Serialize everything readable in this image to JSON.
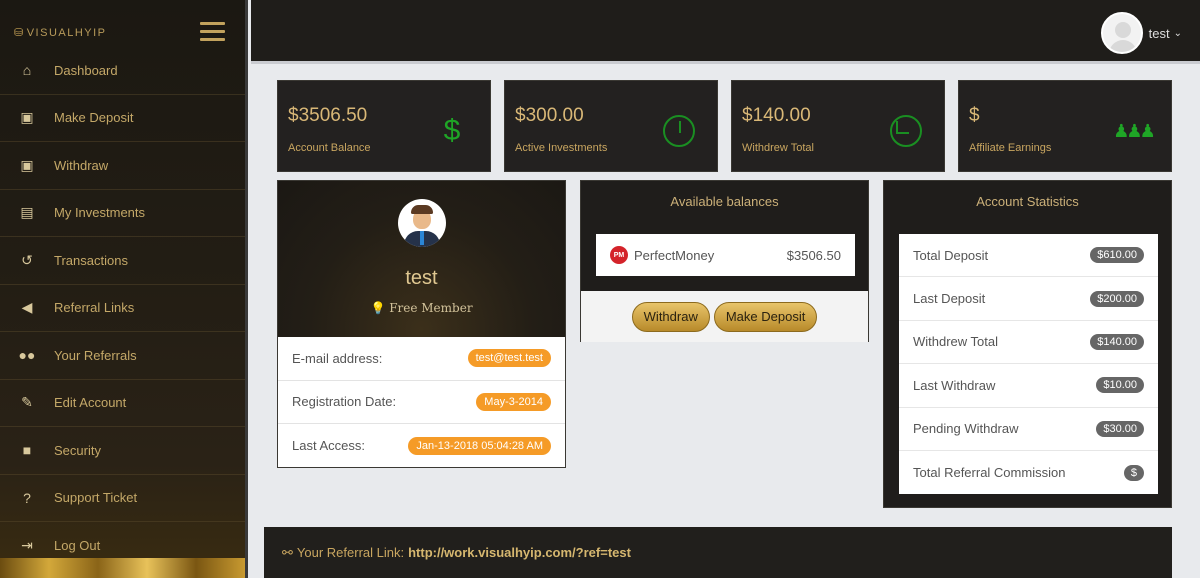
{
  "brand": {
    "name": "VISUALHYIP"
  },
  "sidebar": {
    "items": [
      {
        "label": "Dashboard",
        "icon": "home-icon"
      },
      {
        "label": "Make Deposit",
        "icon": "money-icon"
      },
      {
        "label": "Withdraw",
        "icon": "money-icon"
      },
      {
        "label": "My Investments",
        "icon": "document-icon"
      },
      {
        "label": "Transactions",
        "icon": "history-icon"
      },
      {
        "label": "Referral Links",
        "icon": "megaphone-icon"
      },
      {
        "label": "Your Referrals",
        "icon": "users-icon"
      },
      {
        "label": "Edit Account",
        "icon": "edit-icon"
      },
      {
        "label": "Security",
        "icon": "lock-icon"
      },
      {
        "label": "Support Ticket",
        "icon": "question-icon"
      },
      {
        "label": "Log Out",
        "icon": "logout-icon"
      }
    ]
  },
  "header": {
    "username": "test"
  },
  "stat_cards": [
    {
      "value": "$3506.50",
      "caption": "Account Balance",
      "icon": "dollar-icon"
    },
    {
      "value": "$300.00",
      "caption": "Active Investments",
      "icon": "chart-icon"
    },
    {
      "value": "$140.00",
      "caption": "Withdrew Total",
      "icon": "clock-icon"
    },
    {
      "value": "$",
      "caption": "Affiliate Earnings",
      "icon": "users-icon"
    }
  ],
  "profile": {
    "name": "test",
    "badge": "💡 Free Member",
    "rows": [
      {
        "label": "E-mail address:",
        "value": "test@test.test"
      },
      {
        "label": "Registration Date:",
        "value": "May-3-2014"
      },
      {
        "label": "Last Access:",
        "value": "Jan-13-2018 05:04:28 AM"
      }
    ]
  },
  "balances": {
    "title": "Available balances",
    "processor": "PerfectMoney",
    "processor_logo": "PM",
    "amount": "$3506.50",
    "withdraw_label": "Withdraw",
    "deposit_label": "Make Deposit"
  },
  "stats": {
    "title": "Account Statistics",
    "rows": [
      {
        "label": "Total Deposit",
        "value": "$610.00"
      },
      {
        "label": "Last Deposit",
        "value": "$200.00"
      },
      {
        "label": "Withdrew Total",
        "value": "$140.00"
      },
      {
        "label": "Last Withdraw",
        "value": "$10.00"
      },
      {
        "label": "Pending Withdraw",
        "value": "$30.00"
      },
      {
        "label": "Total Referral Commission",
        "value": "$"
      }
    ]
  },
  "referral": {
    "label": "Your Referral Link:",
    "url": "http://work.visualhyip.com/?ref=test"
  },
  "colors": {
    "gold": "#c9a660",
    "green": "#1fa526",
    "orange": "#f59b27",
    "dark": "#1f1d1b"
  }
}
